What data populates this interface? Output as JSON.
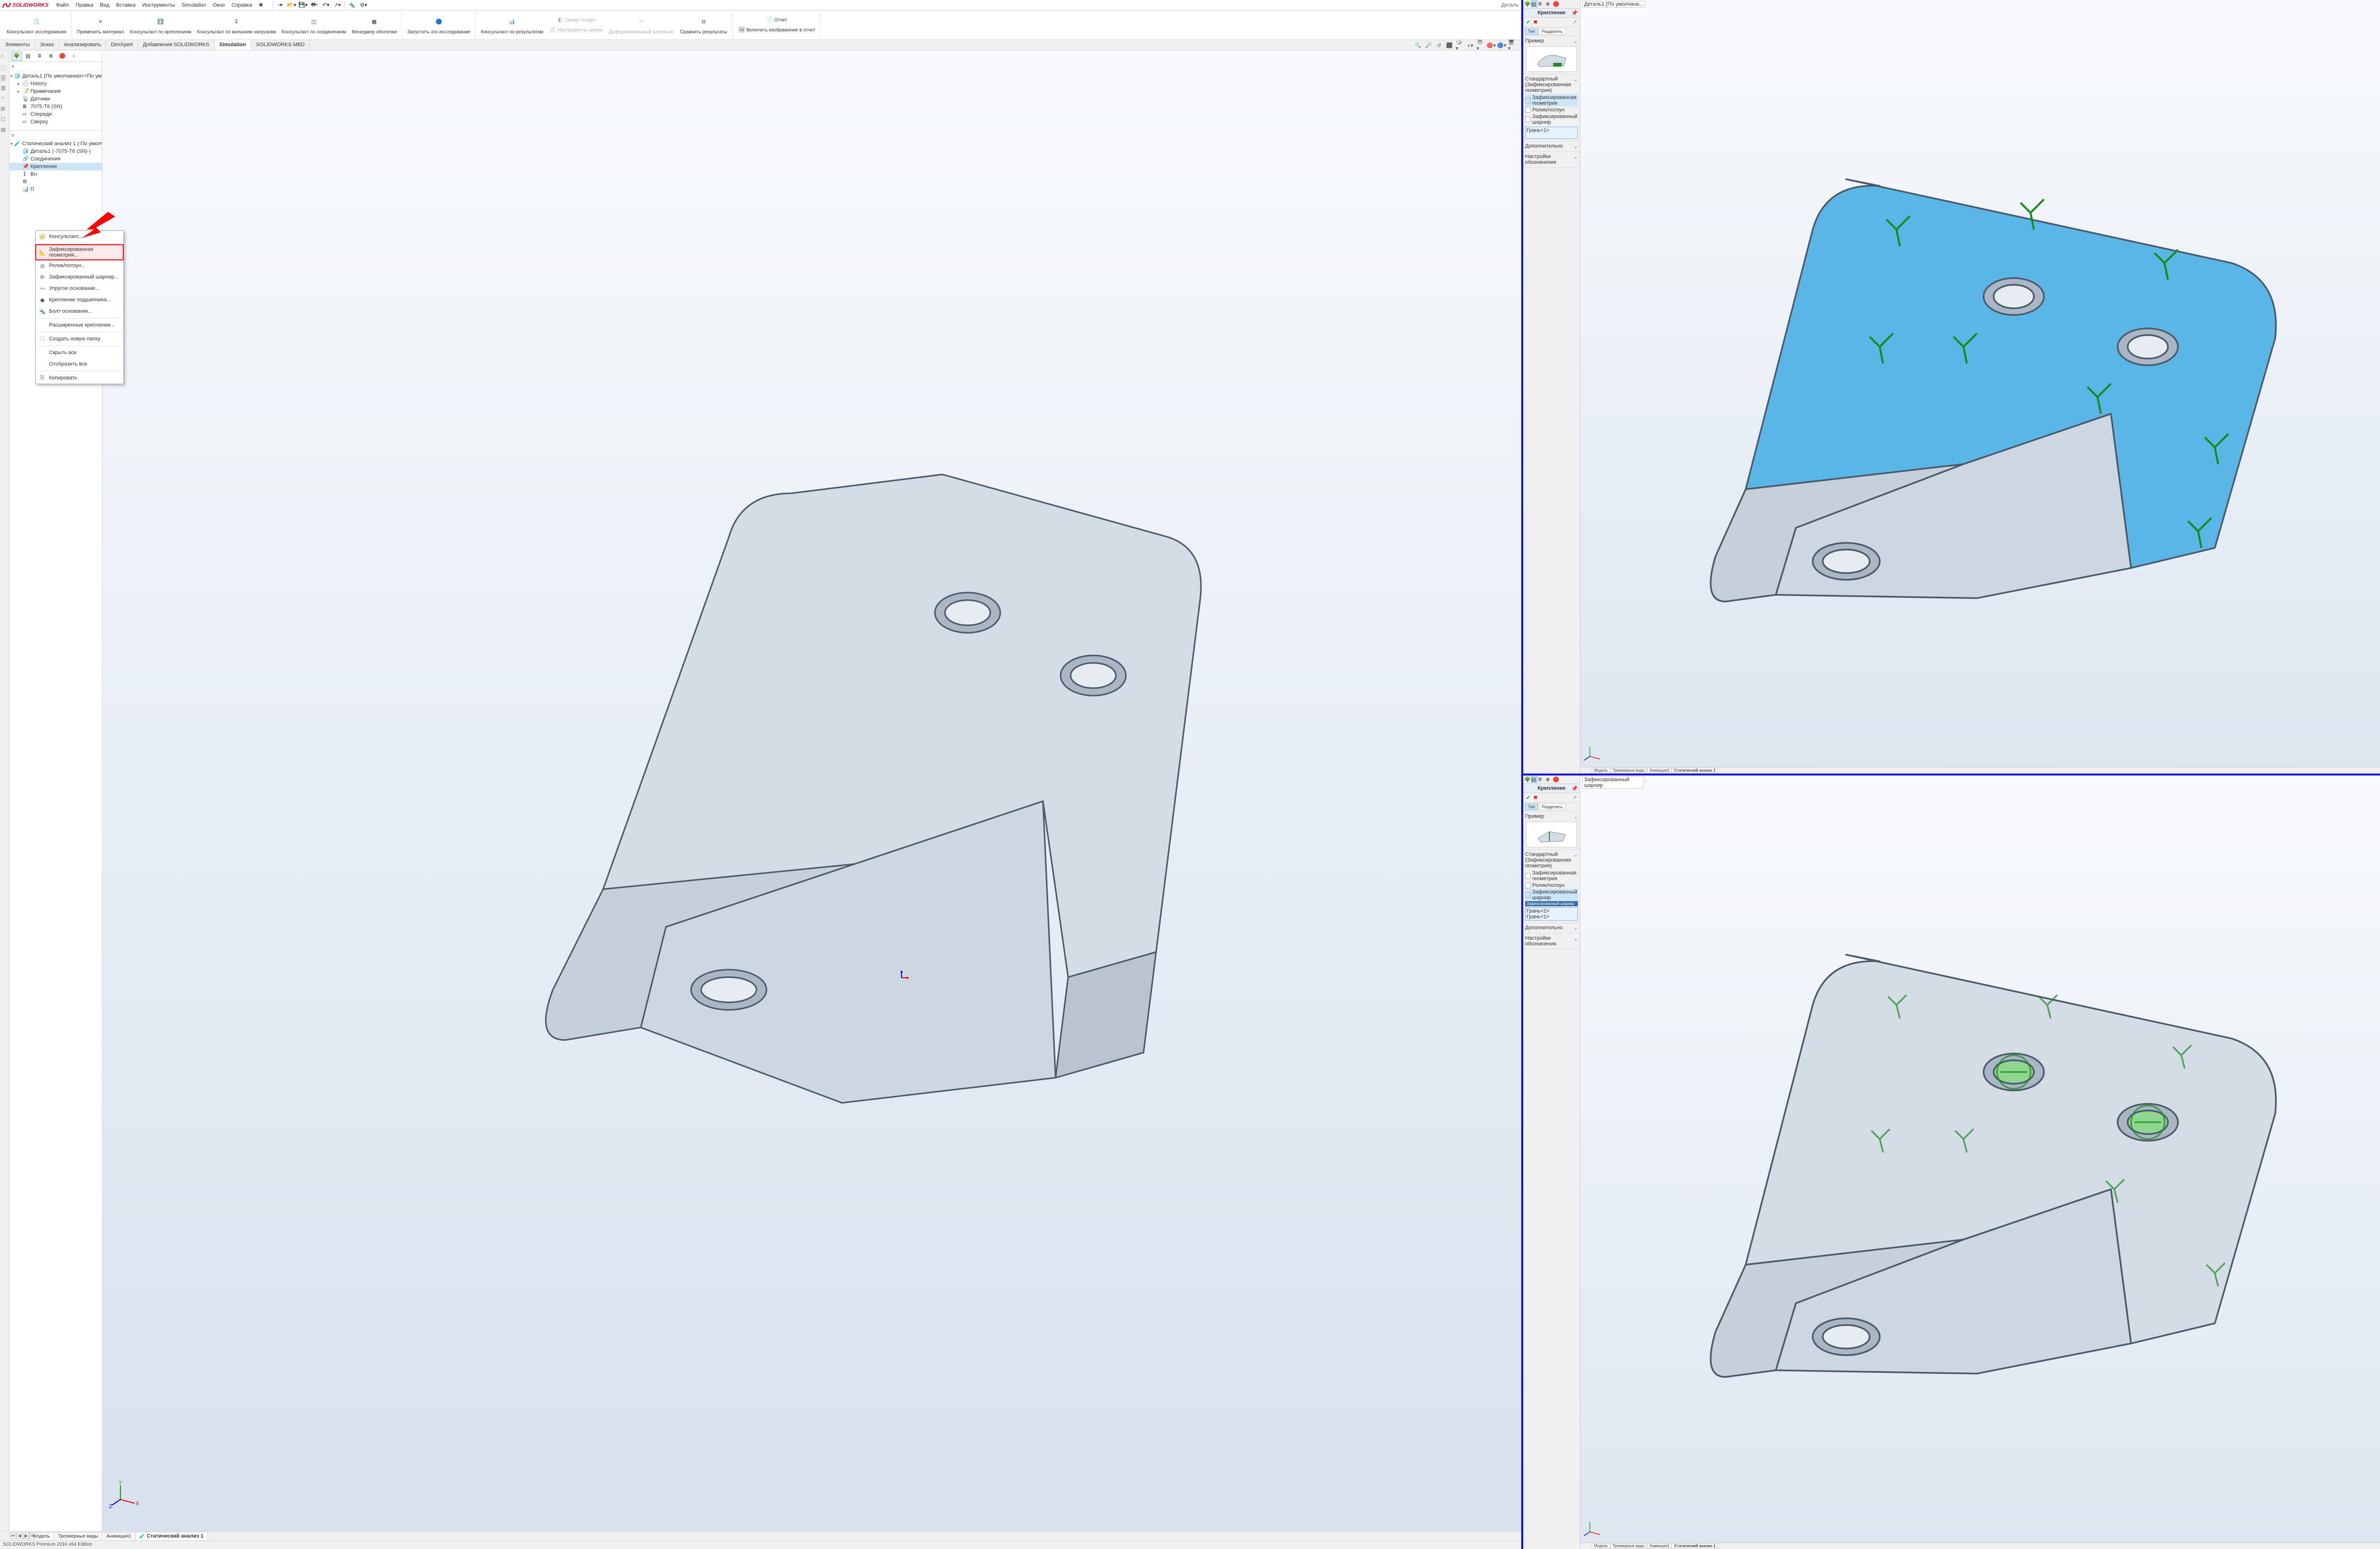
{
  "app": {
    "name": "SOLIDWORKS",
    "docname": "Деталь",
    "edition": "SOLIDWORKS Premium 2016 x64 Edition"
  },
  "menu": {
    "file": "Файл",
    "edit": "Правка",
    "view": "Вид",
    "insert": "Вставка",
    "tools": "Инструменты",
    "simulation": "Simulation",
    "window": "Окно",
    "help": "Справка"
  },
  "ribbon": {
    "study_advisor": "Консультант исследования",
    "apply_material": "Применить материал",
    "fixtures_advisor": "Консультант по креплениям",
    "loads_advisor": "Консультант по внешним нагрузкам",
    "connections_advisor": "Консультант по соединениям",
    "shell_manager": "Менеджер оболочки",
    "run_study": "Запустить это исследование",
    "results_advisor": "Консультант по результатам",
    "design_insight": "Design Insight",
    "deformed_result": "Деформированный результат",
    "compare_results": "Сравнить результаты",
    "plot_tools": "Инструменты эпюры",
    "report": "Отчет",
    "include_image": "Включить изображение в отчет"
  },
  "tabs": {
    "features": "Элементы",
    "sketch": "Эскиз",
    "analyze": "Анализировать",
    "dimxpert": "DimXpert",
    "addins": "Добавления SOLIDWORKS",
    "simulation": "Simulation",
    "mbd": "SOLIDWORKS MBD"
  },
  "tree": {
    "root": "Деталь1  (По умолчанию<<По умол",
    "history": "History",
    "annotations": "Примечания",
    "sensors": "Датчики",
    "material": "7075-T6 (SN)",
    "front": "Спереди",
    "top": "Сверху",
    "study": "Статический анализ 1 (-По умолчанию-",
    "study_part": "Деталь1 (-7075-T6 (SN)-)",
    "connections": "Соединения",
    "fixtures": "Крепления",
    "ext_truncated": "Вн",
    "result_truncated": "П"
  },
  "ctx": {
    "advisor": "Консультант...",
    "fixed": "Зафиксированная геометрия...",
    "roller": "Ролик/ползун...",
    "hinge": "Зафиксированный шарнир...",
    "elastic": "Упругое основание...",
    "bearing": "Крепление подшипника...",
    "bolt": "Болт основания...",
    "advanced": "Расширенные крепления...",
    "newfolder": "Создать новую папку",
    "hideall": "Скрыть все",
    "showall": "Отобразить все",
    "copy": "Копировать"
  },
  "btabs": {
    "model": "Модель",
    "views3d": "Трехмерные виды",
    "motion": "Анимация1",
    "study": "Статический анализ 1"
  },
  "pm": {
    "title": "Крепление",
    "tab_type": "Тип",
    "tab_split": "Разделить",
    "example": "Пример",
    "standard": "Стандартный (Зафиксированная геометрия)",
    "fixed": "Зафиксированная геометрия",
    "roller": "Ролик/ползун",
    "hinge": "Зафиксированный шарнир",
    "face1": "Грань<1>",
    "face2": "Грань<2>",
    "advanced": "Дополнительно",
    "symbol": "Настройки обозначения",
    "hinge_sel": "Зафиксированный шарнир"
  },
  "mini_crumb": {
    "part": "Деталь1  (По умолчани...",
    "hinge": "Зафиксированный шарнир"
  }
}
